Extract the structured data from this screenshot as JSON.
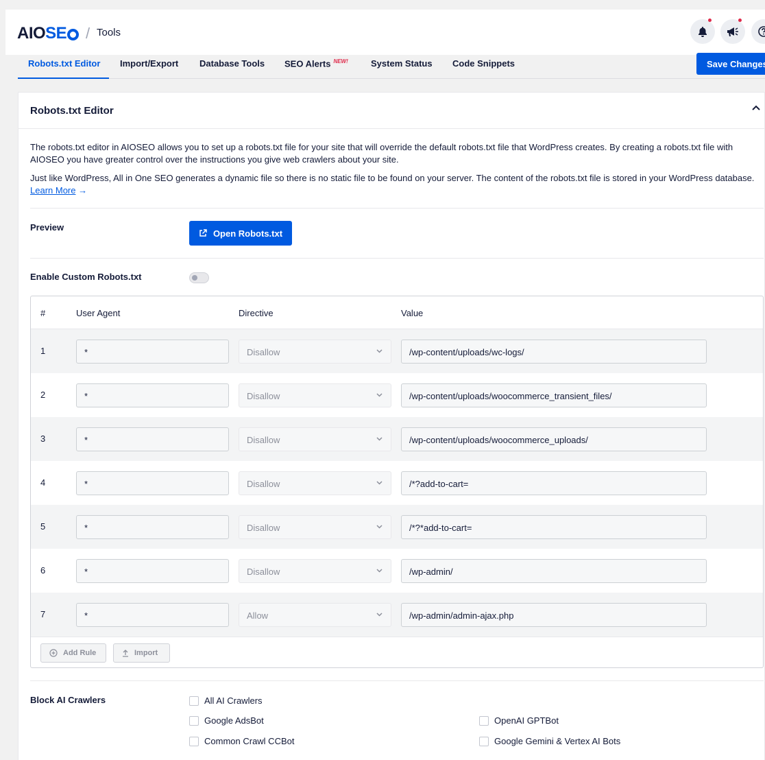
{
  "header": {
    "logo_part1": "AIO",
    "logo_part2": "SE",
    "separator": "/",
    "breadcrumb": "Tools"
  },
  "tabs": [
    {
      "label": "Robots.txt Editor",
      "active": true
    },
    {
      "label": "Import/Export"
    },
    {
      "label": "Database Tools"
    },
    {
      "label": "SEO Alerts",
      "badge": "NEW!"
    },
    {
      "label": "System Status"
    },
    {
      "label": "Code Snippets"
    }
  ],
  "save_label": "Save Changes",
  "card": {
    "title": "Robots.txt Editor",
    "desc1": "The robots.txt editor in AIOSEO allows you to set up a robots.txt file for your site that will override the default robots.txt file that WordPress creates. By creating a robots.txt file with AIOSEO you have greater control over the instructions you give web crawlers about your site.",
    "desc2": "Just like WordPress, All in One SEO generates a dynamic file so there is no static file to be found on your server. The content of the robots.txt file is stored in your WordPress database.",
    "learn_more": "Learn More",
    "learn_arrow": "→",
    "preview_label": "Preview",
    "open_label": "Open Robots.txt",
    "enable_label": "Enable Custom Robots.txt"
  },
  "table": {
    "headers": {
      "num": "#",
      "ua": "User Agent",
      "dir": "Directive",
      "val": "Value"
    },
    "rows": [
      {
        "num": "1",
        "ua": "*",
        "dir": "Disallow",
        "val": "/wp-content/uploads/wc-logs/"
      },
      {
        "num": "2",
        "ua": "*",
        "dir": "Disallow",
        "val": "/wp-content/uploads/woocommerce_transient_files/"
      },
      {
        "num": "3",
        "ua": "*",
        "dir": "Disallow",
        "val": "/wp-content/uploads/woocommerce_uploads/"
      },
      {
        "num": "4",
        "ua": "*",
        "dir": "Disallow",
        "val": "/*?add-to-cart="
      },
      {
        "num": "5",
        "ua": "*",
        "dir": "Disallow",
        "val": "/*?*add-to-cart="
      },
      {
        "num": "6",
        "ua": "*",
        "dir": "Disallow",
        "val": "/wp-admin/"
      },
      {
        "num": "7",
        "ua": "*",
        "dir": "Allow",
        "val": "/wp-admin/admin-ajax.php"
      }
    ],
    "add_rule": "Add Rule",
    "import": "Import"
  },
  "ai": {
    "label": "Block AI Crawlers",
    "options": [
      "All AI Crawlers",
      "Google AdsBot",
      "OpenAI GPTBot",
      "Common Crawl CCBot",
      "Google Gemini & Vertex AI Bots"
    ]
  },
  "colors": {
    "accent": "#005ae0",
    "alert": "#df2a4a",
    "text": "#141b38"
  }
}
